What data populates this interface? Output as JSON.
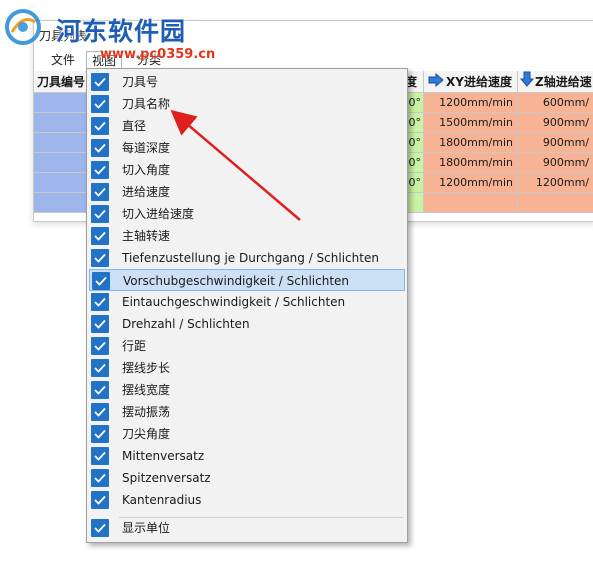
{
  "window": {
    "title": "刀具列表",
    "menu": [
      "文件",
      "视图",
      "分类"
    ]
  },
  "grid": {
    "headers": [
      "刀具编号",
      "度",
      "XY进给速度",
      "Z轴进给速"
    ],
    "rows": [
      {
        "angle": "0°",
        "xy": "1200mm/min",
        "z": "600mm/"
      },
      {
        "angle": "0°",
        "xy": "1500mm/min",
        "z": "900mm/"
      },
      {
        "angle": "0°",
        "xy": "1800mm/min",
        "z": "900mm/"
      },
      {
        "angle": "0°",
        "xy": "1800mm/min",
        "z": "900mm/"
      },
      {
        "angle": "0°",
        "xy": "1200mm/min",
        "z": "1200mm/"
      },
      {
        "angle": "",
        "xy": "",
        "z": ""
      }
    ]
  },
  "watermark": {
    "site_name": "河东软件园",
    "url": "www.pc0359.cn"
  },
  "dropdown": {
    "items": [
      {
        "label": "刀具号",
        "checked": true
      },
      {
        "label": "刀具名称",
        "checked": true
      },
      {
        "label": "直径",
        "checked": true
      },
      {
        "label": "每道深度",
        "checked": true
      },
      {
        "label": "切入角度",
        "checked": true
      },
      {
        "label": "进给速度",
        "checked": true
      },
      {
        "label": "切入进给速度",
        "checked": true
      },
      {
        "label": "主轴转速",
        "checked": true
      },
      {
        "label": "Tiefenzustellung je Durchgang / Schlichten",
        "checked": true
      },
      {
        "label": "Vorschubgeschwindigkeit / Schlichten",
        "checked": true,
        "highlighted": true
      },
      {
        "label": "Eintauchgeschwindigkeit / Schlichten",
        "checked": true
      },
      {
        "label": "Drehzahl / Schlichten",
        "checked": true
      },
      {
        "label": "行距",
        "checked": true
      },
      {
        "label": "摆线步长",
        "checked": true
      },
      {
        "label": "摆线宽度",
        "checked": true
      },
      {
        "label": "摆动振荡",
        "checked": true
      },
      {
        "label": "刀尖角度",
        "checked": true
      },
      {
        "label": "Mittenversatz",
        "checked": true
      },
      {
        "label": "Spitzenversatz",
        "checked": true
      },
      {
        "label": "Kantenradius",
        "checked": true
      }
    ],
    "footer_item": {
      "label": "显示单位",
      "checked": true
    }
  },
  "colors": {
    "check_bg": "#2272c5",
    "highlight": "#cce0f5",
    "annotation_arrow": "#e02020",
    "cell_blue": "#9db5ea",
    "cell_green": "#c9f2a4",
    "cell_salmon": "#f7b394"
  }
}
